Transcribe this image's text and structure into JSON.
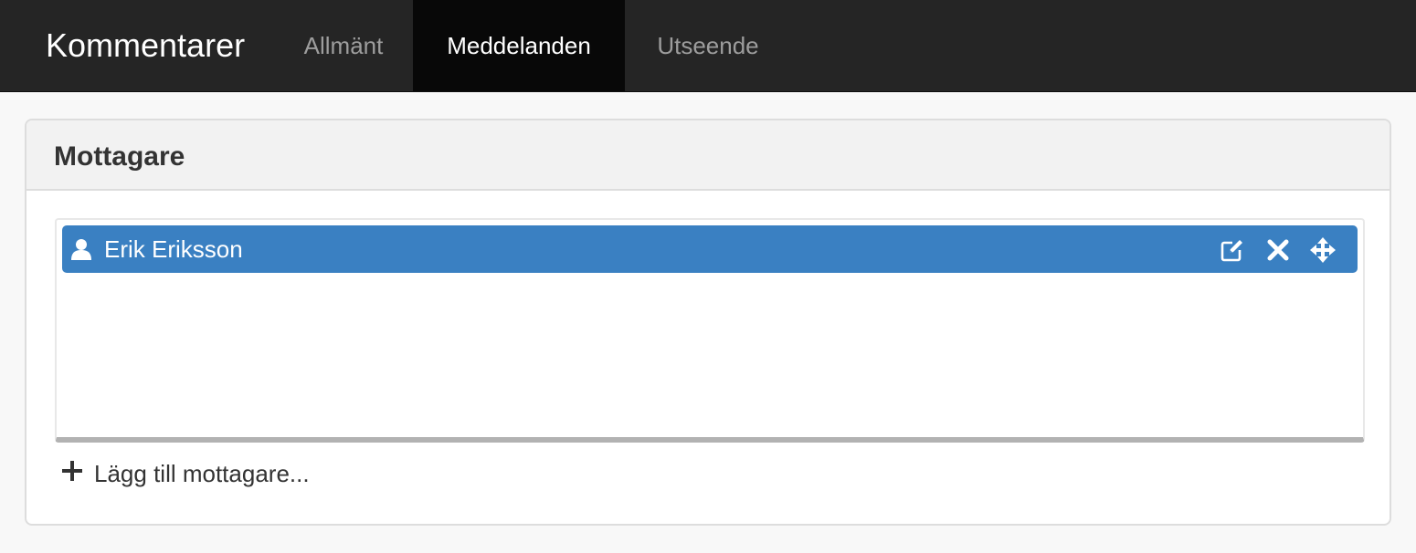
{
  "navbar": {
    "brand": "Kommentarer",
    "tabs": [
      {
        "label": "Allmänt",
        "active": false
      },
      {
        "label": "Meddelanden",
        "active": true
      },
      {
        "label": "Utseende",
        "active": false
      }
    ]
  },
  "panel": {
    "title": "Mottagare",
    "recipients": [
      {
        "name": "Erik Eriksson",
        "icon": "user-icon",
        "actions": [
          "edit-icon",
          "close-icon",
          "move-icon"
        ]
      }
    ],
    "add_label": "Lägg till mottagare..."
  },
  "colors": {
    "navbar_bg": "#252525",
    "active_tab_bg": "#080808",
    "recipient_bg": "#3a80c2"
  }
}
